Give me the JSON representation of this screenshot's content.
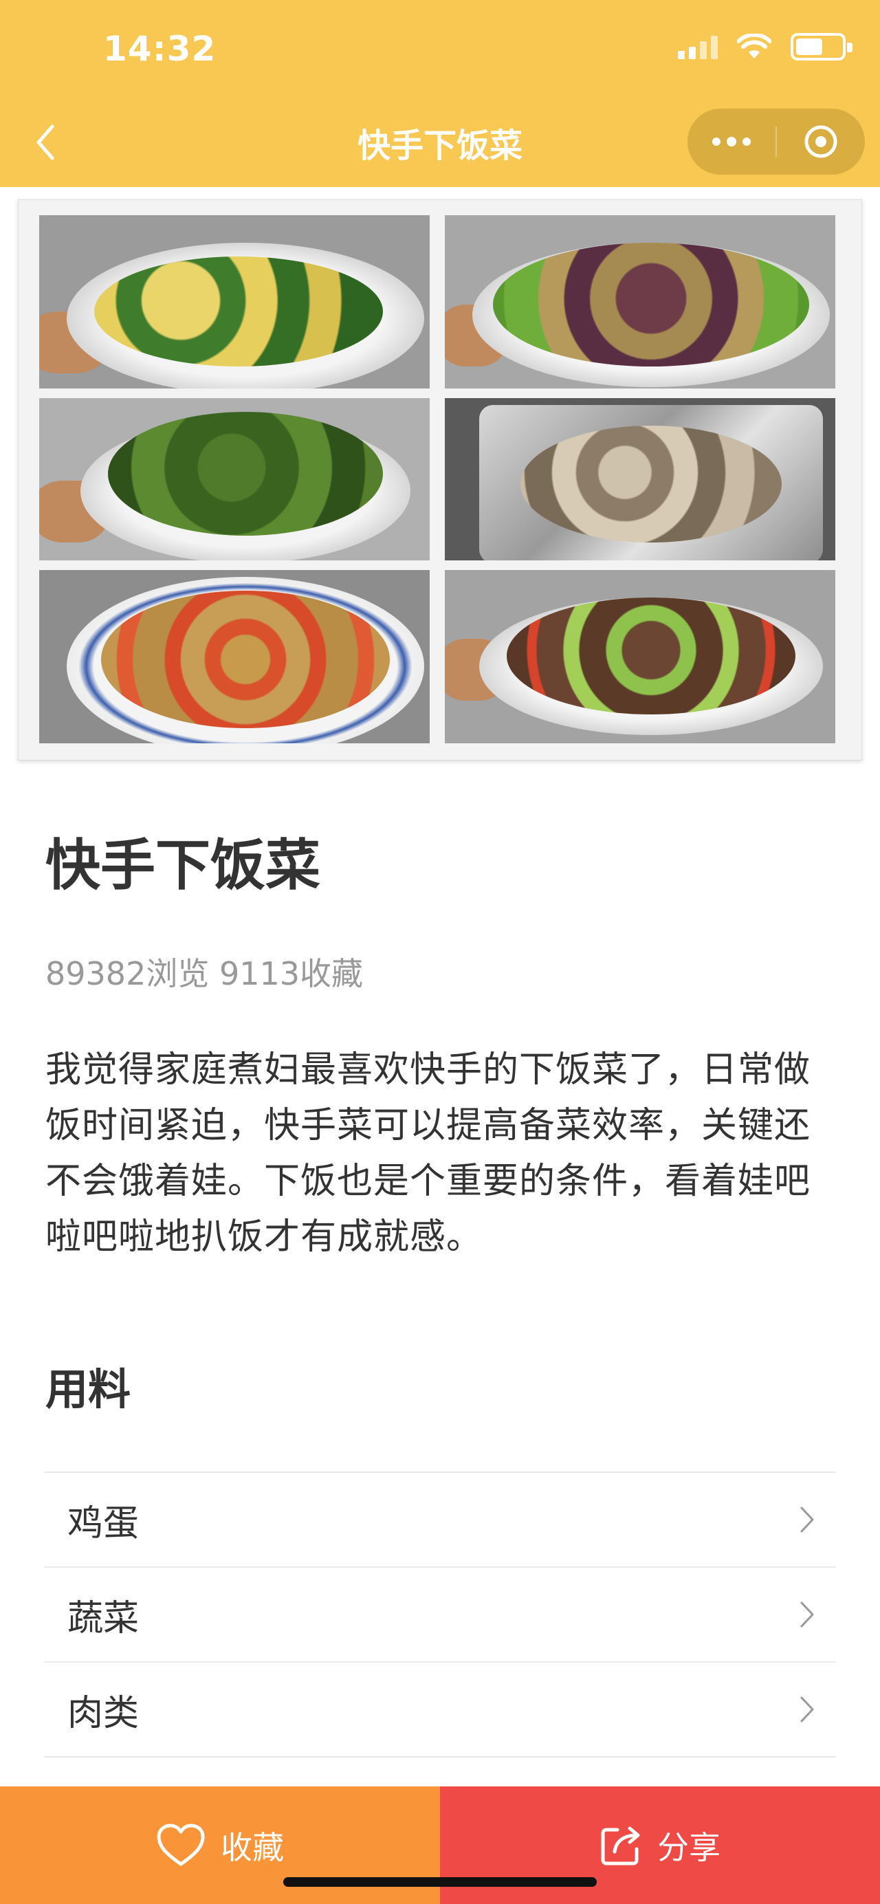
{
  "status_bar": {
    "time": "14:32"
  },
  "nav": {
    "title": "快手下饭菜"
  },
  "hero": {
    "dishes": [
      "okra-egg",
      "eggplant",
      "green-beans",
      "clams-foil",
      "tripe-tomato",
      "beef-celery"
    ]
  },
  "recipe": {
    "title": "快手下饭菜",
    "stats": "89382浏览 9113收藏",
    "description": "我觉得家庭煮妇最喜欢快手的下饭菜了，日常做饭时间紧迫，快手菜可以提高备菜效率，关键还不会饿着娃。下饭也是个重要的条件，看着娃吧啦吧啦地扒饭才有成就感。"
  },
  "ingredients": {
    "section_title": "用料",
    "items": [
      {
        "label": "鸡蛋"
      },
      {
        "label": "蔬菜"
      },
      {
        "label": "肉类"
      }
    ]
  },
  "bottom_bar": {
    "favorite_label": "收藏",
    "share_label": "分享"
  },
  "colors": {
    "nav_bg": "#f8c852",
    "favorite_bg": "#f99538",
    "share_bg": "#f04a46"
  }
}
